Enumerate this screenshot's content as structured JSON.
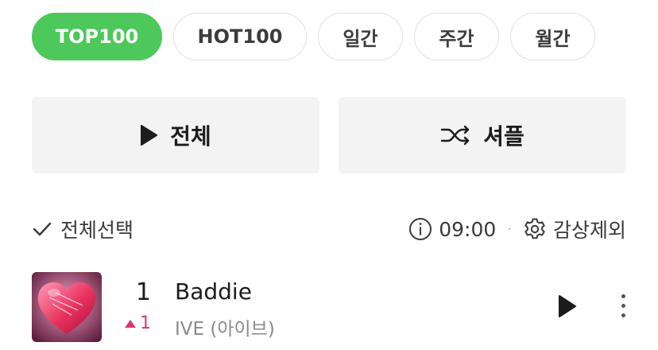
{
  "chips": [
    {
      "label": "TOP100",
      "active": true
    },
    {
      "label": "HOT100",
      "active": false
    },
    {
      "label": "일간",
      "active": false
    },
    {
      "label": "주간",
      "active": false
    },
    {
      "label": "월간",
      "active": false
    }
  ],
  "actions": {
    "play_all_label": "전체",
    "shuffle_label": "셔플"
  },
  "toolbar": {
    "select_all_label": "전체선택",
    "time": "09:00",
    "exclude_label": "감상제외"
  },
  "tracks": [
    {
      "rank": "1",
      "change": "1",
      "title": "Baddie",
      "artist": "IVE (아이브)"
    }
  ],
  "colors": {
    "accent": "#4cc95a",
    "rank_up": "#e0366d"
  }
}
